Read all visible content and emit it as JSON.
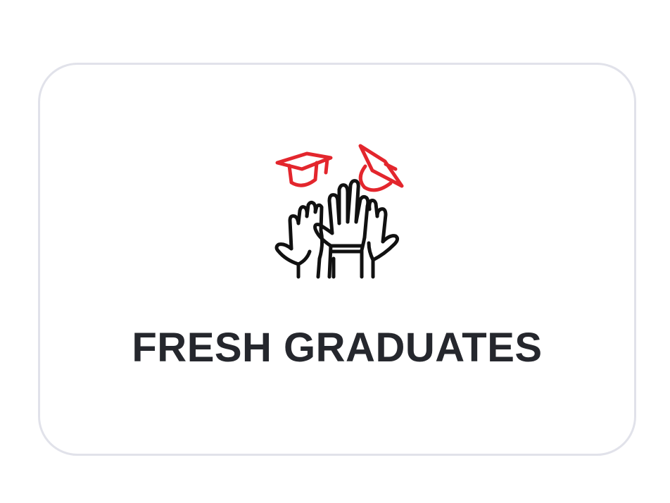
{
  "card": {
    "title": "FRESH GRADUATES",
    "icon": "graduates-celebrating-icon"
  },
  "colors": {
    "accent": "#e3262d",
    "text": "#25272d",
    "card_border": "#e1e2ea",
    "icon_line": "#111111"
  }
}
